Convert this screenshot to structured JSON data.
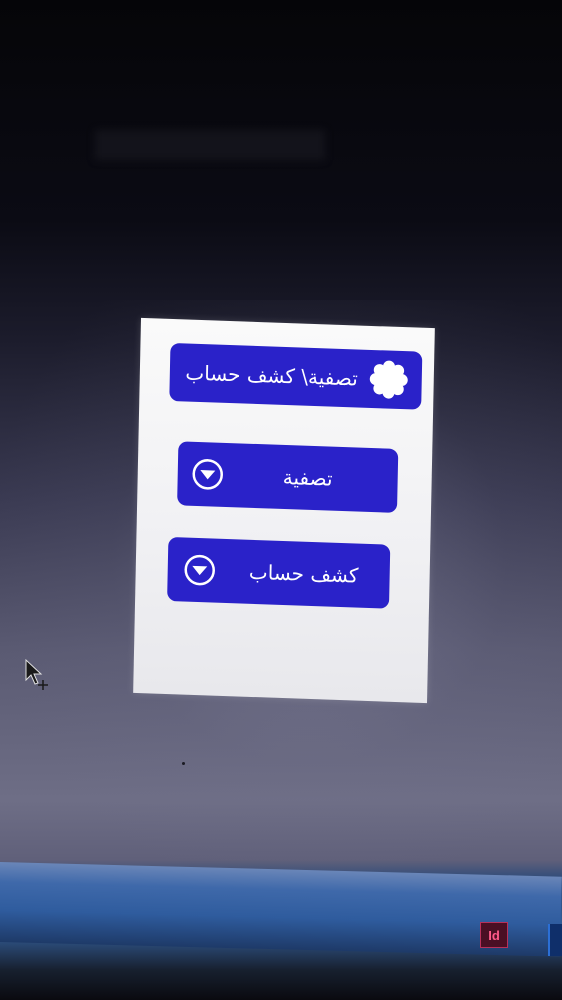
{
  "panel": {
    "header_title": "تصفية\\ كشف حساب",
    "buttons": [
      {
        "label": "تصفية",
        "icon": "chevron-down-circle-icon"
      },
      {
        "label": "كشف حساب",
        "icon": "chevron-down-circle-icon"
      }
    ],
    "header_icon": "flower-icon"
  },
  "taskbar": {
    "app_icon_text": "Id"
  },
  "colors": {
    "button_bg": "#2a22c9",
    "panel_bg": "#f3f3f6",
    "text": "#ffffff"
  }
}
